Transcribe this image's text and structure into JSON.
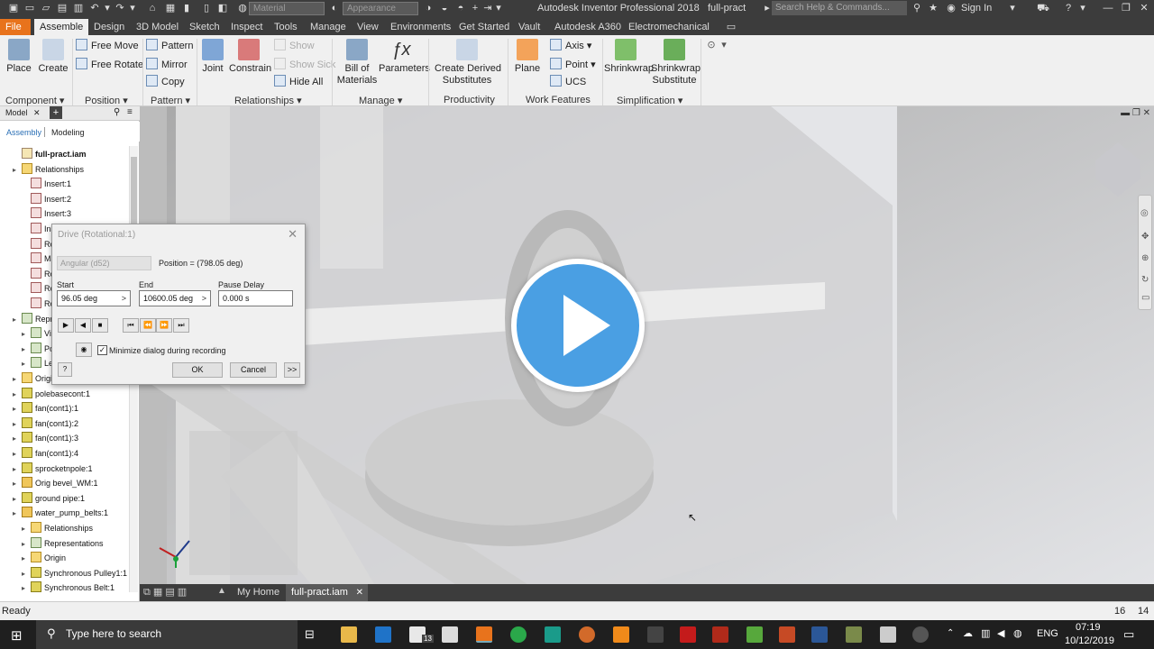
{
  "title_bar": {
    "app_title": "Autodesk Inventor Professional 2018",
    "document": "full-pract",
    "search_placeholder": "Search Help & Commands...",
    "material_combo": "Material",
    "appearance_combo": "Appearance",
    "sign_in": "Sign In",
    "help_symbol": "?"
  },
  "ribbon_tabs": [
    "File",
    "Assemble",
    "Design",
    "3D Model",
    "Sketch",
    "Inspect",
    "Tools",
    "Manage",
    "View",
    "Environments",
    "Get Started",
    "Vault",
    "Autodesk A360",
    "Electromechanical"
  ],
  "ribbon": {
    "component": {
      "place": "Place",
      "create": "Create",
      "label": "Component"
    },
    "position": {
      "free_move": "Free Move",
      "free_rotate": "Free Rotate",
      "label": "Position"
    },
    "pattern": {
      "pattern": "Pattern",
      "mirror": "Mirror",
      "copy": "Copy",
      "label": "Pattern"
    },
    "relationships": {
      "joint": "Joint",
      "constrain": "Constrain",
      "show": "Show",
      "show_sick": "Show Sick",
      "hide_all": "Hide All",
      "label": "Relationships"
    },
    "manage": {
      "bom_line1": "Bill of",
      "bom_line2": "Materials",
      "parameters": "Parameters",
      "label": "Manage"
    },
    "productivity": {
      "cds_line1": "Create Derived",
      "cds_line2": "Substitutes",
      "label": "Productivity"
    },
    "work_features": {
      "plane": "Plane",
      "axis": "Axis",
      "point": "Point",
      "ucs": "UCS",
      "label": "Work Features"
    },
    "simplification": {
      "shrinkwrap": "Shrinkwrap",
      "sws_line1": "Shrinkwrap",
      "sws_line2": "Substitute",
      "label": "Simplification"
    }
  },
  "browser": {
    "tab_model": "Model",
    "tab_close": "✕",
    "tab_add": "+",
    "assembly_tab": "Assembly",
    "modeling_tab": "Modeling",
    "tree": [
      {
        "label": "full-pract.iam",
        "type": "root"
      },
      {
        "label": "Relationships",
        "type": "fold"
      },
      {
        "label": "Insert:1",
        "type": "rel"
      },
      {
        "label": "Insert:2",
        "type": "rel"
      },
      {
        "label": "Insert:3",
        "type": "rel"
      },
      {
        "label": "Ins",
        "type": "rel"
      },
      {
        "label": "Rot",
        "type": "rel"
      },
      {
        "label": "Ma",
        "type": "rel"
      },
      {
        "label": "Rot",
        "type": "rel"
      },
      {
        "label": "Rot",
        "type": "rel"
      },
      {
        "label": "Rot",
        "type": "rel"
      },
      {
        "label": "Repres",
        "type": "rep"
      },
      {
        "label": "Vie",
        "type": "rep"
      },
      {
        "label": "Pos",
        "type": "rep"
      },
      {
        "label": "Lev",
        "type": "rep"
      },
      {
        "label": "Origin",
        "type": "fold"
      },
      {
        "label": "polebasecont:1",
        "type": "part"
      },
      {
        "label": "fan(cont1):1",
        "type": "part"
      },
      {
        "label": "fan(cont1):2",
        "type": "part"
      },
      {
        "label": "fan(cont1):3",
        "type": "part"
      },
      {
        "label": "fan(cont1):4",
        "type": "part"
      },
      {
        "label": "sprocketnpole:1",
        "type": "part"
      },
      {
        "label": "Orig bevel_WM:1",
        "type": "asm"
      },
      {
        "label": "ground pipe:1",
        "type": "part"
      },
      {
        "label": "water_pump_belts:1",
        "type": "asm"
      },
      {
        "label": "Relationships",
        "type": "fold"
      },
      {
        "label": "Representations",
        "type": "rep"
      },
      {
        "label": "Origin",
        "type": "fold"
      },
      {
        "label": "Synchronous Pulley1:1",
        "type": "part"
      },
      {
        "label": "Synchronous Belt:1",
        "type": "part"
      }
    ]
  },
  "drive_dialog": {
    "title": "Drive (Rotational:1)",
    "type_value": "Angular (d52)",
    "position": "Position = (798.05 deg)",
    "start_label": "Start",
    "start_value": "96.05 deg",
    "end_label": "End",
    "end_value": "10600.05 deg",
    "pause_label": "Pause Delay",
    "pause_value": "0.000 s",
    "minimize_label": "Minimize dialog during recording",
    "minimize_checked": true,
    "ok": "OK",
    "cancel": "Cancel",
    "more": ">>",
    "arrow": ">"
  },
  "document_tabs": {
    "home": "My Home",
    "active": "full-pract.iam"
  },
  "status": {
    "text": "Ready",
    "count1": "16",
    "count2": "14"
  },
  "taskbar": {
    "search": "Type here to search",
    "lang": "ENG",
    "time": "07:19",
    "date": "10/12/2019",
    "badge": "13"
  },
  "colors": {
    "accent": "#e8731c",
    "play": "#4a9fe3",
    "dark": "#3c3c3c"
  }
}
